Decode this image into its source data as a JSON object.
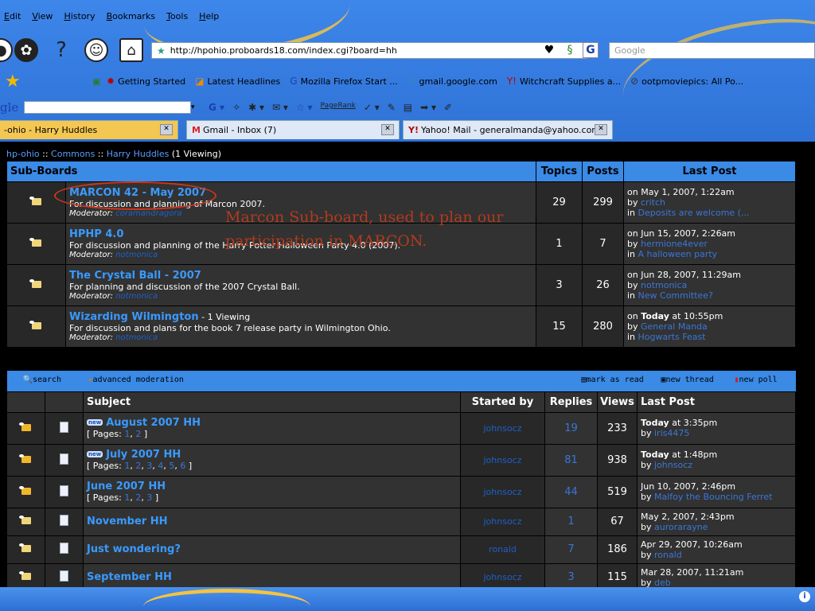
{
  "menu": [
    "Edit",
    "View",
    "History",
    "Bookmarks",
    "Tools",
    "Help"
  ],
  "address": {
    "url": "http://hpohio.proboards18.com/index.cgi?board=hh"
  },
  "search": {
    "placeholder": "Google"
  },
  "bookmarks": [
    "Getting Started",
    "Latest Headlines",
    "Mozilla Firefox Start ...",
    "gmail.google.com",
    "Witchcraft Supplies a...",
    "ootpmoviepics: All Po..."
  ],
  "googlebar": {
    "logo": "gle",
    "pagerank": "PageRank"
  },
  "tabs": [
    {
      "label": "-ohio - Harry Huddles",
      "active": true
    },
    {
      "label": "Gmail - Inbox (7)",
      "prefix": "M"
    },
    {
      "label": "Yahoo! Mail - generalmanda@yahoo.com",
      "prefix": "Y!"
    }
  ],
  "breadcrumb": {
    "a": "hp-ohio",
    "sep": " :: ",
    "b": "Commons",
    "c": "Harry Huddles",
    "viewing": " (1 Viewing)"
  },
  "subboards": {
    "headers": {
      "title": "Sub-Boards",
      "topics": "Topics",
      "posts": "Posts",
      "last": "Last Post"
    },
    "rows": [
      {
        "title": "MARCON 42 - May 2007",
        "viewing": "",
        "desc": "For discussion and planning of Marcon 2007.",
        "mod_label": "Moderator:",
        "mod": "coramandragora",
        "topics": "29",
        "posts": "299",
        "last_on": "on May 1, 2007, 1:22am",
        "last_by": "critch",
        "last_in": "Deposits are welcome (..."
      },
      {
        "title": "HPHP 4.0",
        "viewing": "",
        "desc": "For discussion and planning of the Harry Potter Halloween Party 4.0 (2007).",
        "mod_label": "Moderator:",
        "mod": "notmonica",
        "topics": "1",
        "posts": "7",
        "last_on": "on Jun 15, 2007, 2:26am",
        "last_by": "hermione4ever",
        "last_in": "A halloween party"
      },
      {
        "title": "The Crystal Ball - 2007",
        "viewing": "",
        "desc": "For planning and discussion of the 2007 Crystal Ball.",
        "mod_label": "Moderator:",
        "mod": "notmonica",
        "topics": "3",
        "posts": "26",
        "last_on": "on Jun 28, 2007, 11:29am",
        "last_by": "notmonica",
        "last_in": "New Committee?"
      },
      {
        "title": "Wizarding Wilmington",
        "viewing": " - 1 Viewing",
        "desc": "For discussion and plans for the book 7 release party in Wilmington Ohio.",
        "mod_label": "Moderator:",
        "mod": "notmonica",
        "topics": "15",
        "posts": "280",
        "last_on_pre": "on ",
        "last_on_bold": "Today",
        "last_on_post": " at 10:55pm",
        "last_by": "General Manda",
        "last_in": "Hogwarts Feast"
      }
    ]
  },
  "annotation": "Marcon Sub-board, used to plan our participation in MARCON.",
  "threadtools": {
    "search": "search",
    "advmod": "advanced moderation",
    "markread": "mark as read",
    "newthread": "new thread",
    "newpoll": "new poll"
  },
  "threads": {
    "headers": {
      "subject": "Subject",
      "started": "Started by",
      "replies": "Replies",
      "views": "Views",
      "last": "Last Post"
    },
    "rows": [
      {
        "new": true,
        "title": "August 2007 HH",
        "pages": [
          "1",
          "2"
        ],
        "started": "johnsocz",
        "replies": "19",
        "views": "233",
        "last_bold": "Today",
        "last_rest": " at 3:35pm",
        "last_by": "iris4475",
        "hot": true
      },
      {
        "new": true,
        "title": "July 2007 HH",
        "pages": [
          "1",
          "2",
          "3",
          "4",
          "5",
          "6"
        ],
        "started": "johnsocz",
        "replies": "81",
        "views": "938",
        "last_bold": "Today",
        "last_rest": " at 1:48pm",
        "last_by": "johnsocz",
        "hot": true
      },
      {
        "new": false,
        "title": "June 2007 HH",
        "pages": [
          "1",
          "2",
          "3"
        ],
        "started": "johnsocz",
        "replies": "44",
        "views": "519",
        "last_bold": "",
        "last_rest": "Jun 10, 2007, 2:46pm",
        "last_by": "Malfoy the Bouncing Ferret",
        "hot": true
      },
      {
        "new": false,
        "title": "November HH",
        "pages": [],
        "started": "johnsocz",
        "replies": "1",
        "views": "67",
        "last_bold": "",
        "last_rest": "May 2, 2007, 2:43pm",
        "last_by": "aurorarayne",
        "hot": false
      },
      {
        "new": false,
        "title": "Just wondering?",
        "pages": [],
        "started": "ronald",
        "replies": "7",
        "views": "186",
        "last_bold": "",
        "last_rest": "Apr 29, 2007, 10:26am",
        "last_by": "ronald",
        "hot": false
      },
      {
        "new": false,
        "title": "September HH",
        "pages": [],
        "started": "johnsocz",
        "replies": "3",
        "views": "115",
        "last_bold": "",
        "last_rest": "Mar 28, 2007, 11:21am",
        "last_by": "deb",
        "hot": false
      }
    ],
    "pages_label": "Pages:",
    "by_label": "by",
    "in_label": "in"
  }
}
